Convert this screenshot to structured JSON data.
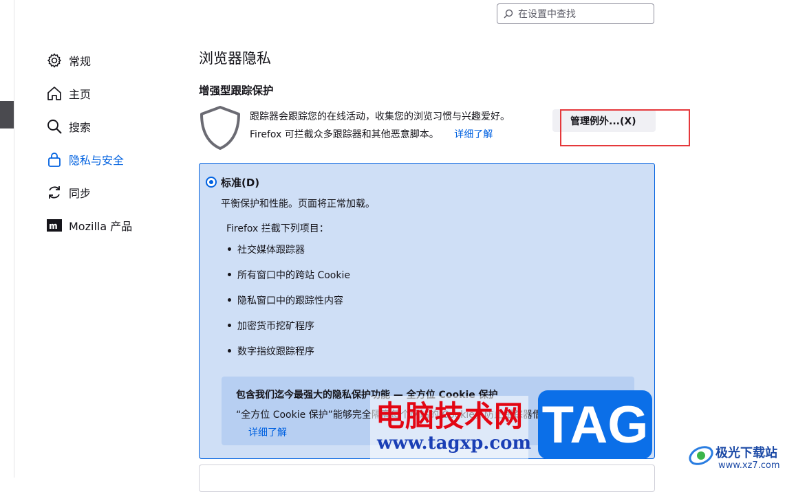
{
  "search": {
    "placeholder": "在设置中查找"
  },
  "sidebar": {
    "items": [
      {
        "label": "常规",
        "icon": "gear-icon",
        "active": false
      },
      {
        "label": "主页",
        "icon": "home-icon",
        "active": false
      },
      {
        "label": "搜索",
        "icon": "search-icon",
        "active": false
      },
      {
        "label": "隐私与安全",
        "icon": "lock-icon",
        "active": true
      },
      {
        "label": "同步",
        "icon": "sync-icon",
        "active": false
      },
      {
        "label": "Mozilla 产品",
        "icon": "mozilla-icon",
        "active": false
      }
    ]
  },
  "main": {
    "page_title": "浏览器隐私",
    "etp": {
      "title": "增强型跟踪保护",
      "desc_line1": "跟踪器会跟踪您的在线活动，收集您的浏览习惯与兴趣爱好。",
      "desc_line2": "Firefox 可拦截众多跟踪器和其他恶意脚本。",
      "learn_more": "详细了解",
      "manage_button": "管理例外...(X)"
    },
    "standard": {
      "label": "标准(D)",
      "selected": true,
      "description": "平衡保护和性能。页面将正常加载。",
      "blocks_title": "Firefox 拦截下列项目：",
      "items": [
        "社交媒体跟踪器",
        "所有窗口中的跨站 Cookie",
        "隐私窗口中的跟踪性内容",
        "加密货币挖矿程序",
        "数字指纹跟踪程序"
      ],
      "info": {
        "title": "包含我们迄今最强大的隐私保护功能 — 全方位 Cookie 保护",
        "text": "“全方位 Cookie 保护”能够完全隔离每个网站的 Cookie，防止跟踪器借此跨站跟踪您。",
        "learn_more": "详细了解"
      }
    }
  },
  "watermark": {
    "cn_text": "电脑技术网",
    "url": "www.tagxp.com",
    "tag": "TAG",
    "site_name": "极光下载站",
    "site_url": "www.xz7.com"
  },
  "colors": {
    "accent": "#0061e0",
    "card_bg": "#cfdff6",
    "highlight_box": "#e5383b"
  }
}
